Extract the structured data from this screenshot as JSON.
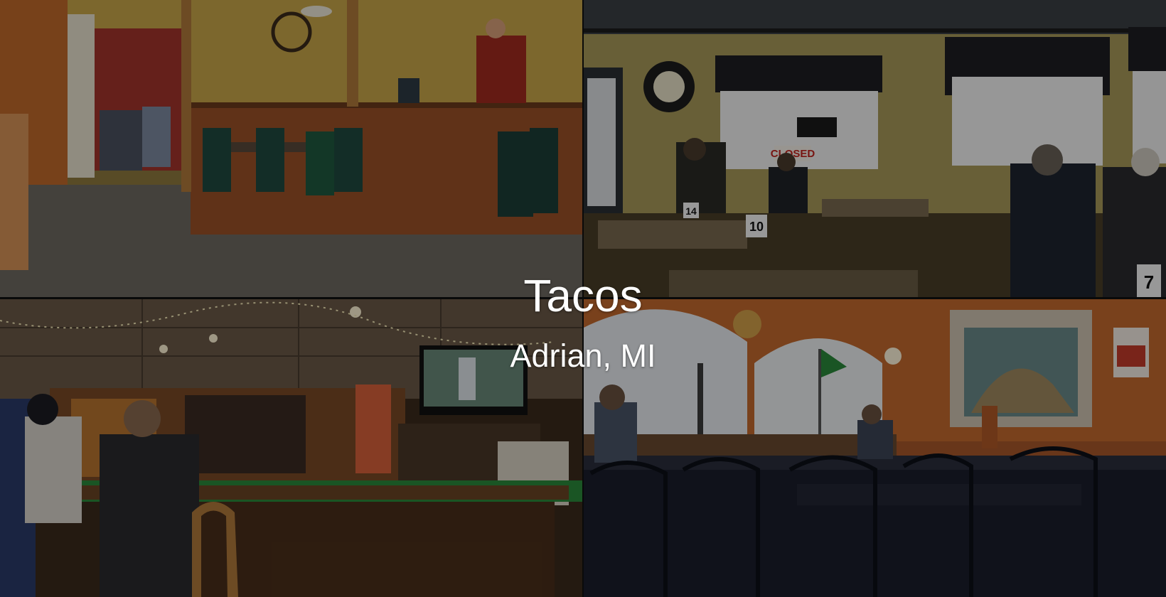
{
  "caption": {
    "title": "Tacos",
    "subtitle": "Adrian, MI"
  },
  "photos": [
    {
      "scene": "diner-interior-counter-and-green-chairs"
    },
    {
      "scene": "dining-room-with-numbered-tables-and-windows"
    },
    {
      "scene": "bar-with-string-lights-and-tv"
    },
    {
      "scene": "dining-room-with-arched-windows-and-mural"
    }
  ],
  "signs": {
    "window_sign": "CLOSED",
    "table_numbers": [
      "14",
      "10",
      "7"
    ]
  },
  "colors": {
    "overlay": "#000000",
    "caption_text": "#ffffff"
  }
}
